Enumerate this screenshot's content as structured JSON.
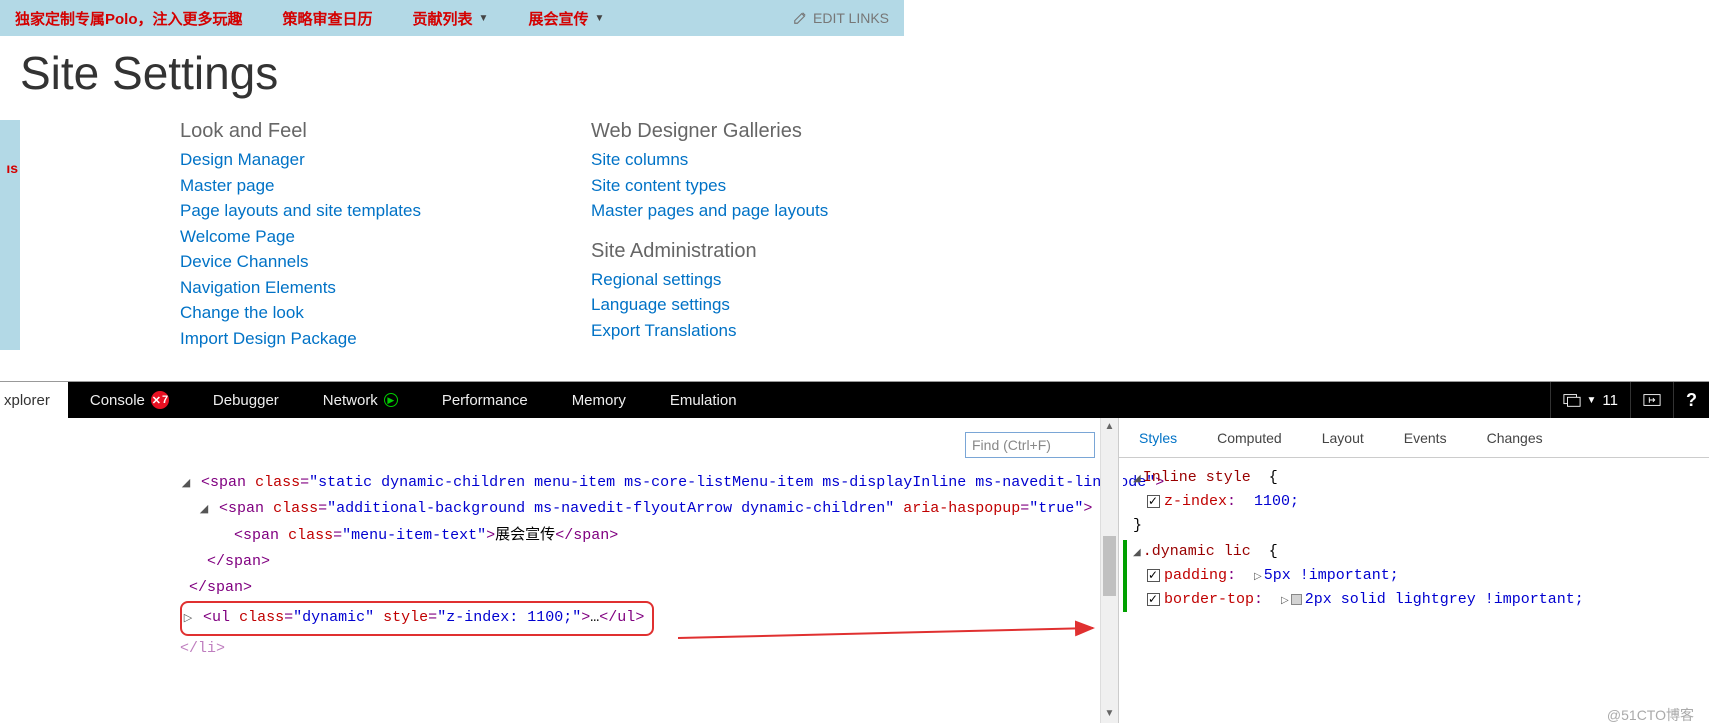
{
  "nav": {
    "promo": "独家定制专属Polo，注入更多玩趣",
    "items": [
      "策略审查日历",
      "贡献列表",
      "展会宣传"
    ],
    "edit_links": "EDIT LINKS"
  },
  "page_title": "Site Settings",
  "left_frag": "ıs",
  "sections": {
    "look_and_feel": {
      "heading": "Look and Feel",
      "links": [
        "Design Manager",
        "Master page",
        "Page layouts and site templates",
        "Welcome Page",
        "Device Channels",
        "Navigation Elements",
        "Change the look",
        "Import Design Package"
      ]
    },
    "web_designer": {
      "heading": "Web Designer Galleries",
      "links": [
        "Site columns",
        "Site content types",
        "Master pages and page layouts"
      ]
    },
    "site_admin": {
      "heading": "Site Administration",
      "links": [
        "Regional settings",
        "Language settings",
        "Export Translations"
      ]
    }
  },
  "devtools": {
    "tabs": {
      "explorer": "xplorer",
      "console": "Console",
      "console_count": "7",
      "debugger": "Debugger",
      "network": "Network",
      "performance": "Performance",
      "memory": "Memory",
      "emulation": "Emulation"
    },
    "right": {
      "count": "11",
      "help": "?"
    },
    "search_placeholder": "Find (Ctrl+F)",
    "dom": {
      "l1_class": "static dynamic-children menu-item ms-core-listMenu-item ms-displayInline ms-navedit-linkNode",
      "l2_class": "additional-background ms-navedit-flyoutArrow dynamic-children",
      "l2_aria": "true",
      "l3_class": "menu-item-text",
      "l3_text": "展会宣传",
      "l4_close1": "</span>",
      "l4_close2": "</span>",
      "l5_class": "dynamic",
      "l5_style": "z-index: 1100;",
      "l5_rest": "…",
      "l6": "</li>",
      "span": "span",
      "ul": "ul",
      "class_kw": "class",
      "style_kw": "style",
      "aria_kw": "aria-haspopup"
    },
    "styles": {
      "tabs": [
        "Styles",
        "Computed",
        "Layout",
        "Events",
        "Changes"
      ],
      "rule1": {
        "selector": "Inline style",
        "props": [
          {
            "name": "z-index",
            "value": "1100;"
          }
        ]
      },
      "rule2": {
        "selector": ".dynamic lic",
        "props": [
          {
            "name": "padding",
            "value": "5px !important;"
          },
          {
            "name": "border-top",
            "value": "2px solid lightgrey !important;",
            "swatch": "#d3d3d3"
          }
        ]
      }
    }
  },
  "watermark": "@51CTO博客"
}
